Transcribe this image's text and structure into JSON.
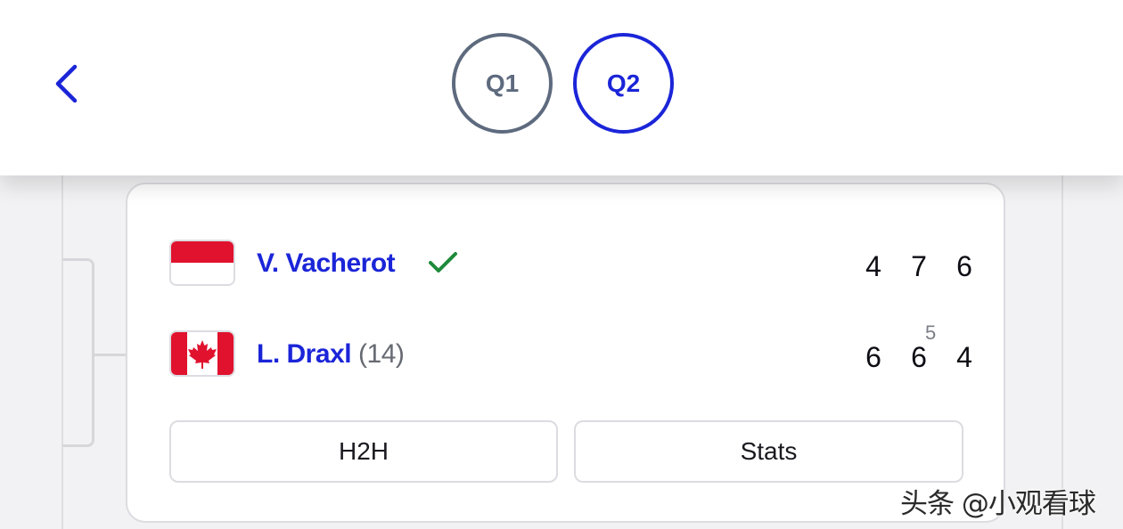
{
  "header": {
    "tabs": [
      {
        "label": "Q1",
        "active": false
      },
      {
        "label": "Q2",
        "active": true
      }
    ]
  },
  "match": {
    "players": [
      {
        "name": "V. Vacherot",
        "seed": "",
        "flag": "monaco-flag",
        "winner": true,
        "scores": [
          "4",
          "7",
          "6"
        ],
        "tiebreak": ""
      },
      {
        "name": "L. Draxl",
        "seed": "(14)",
        "flag": "canada-flag",
        "winner": false,
        "scores": [
          "6",
          "6",
          "4"
        ],
        "tiebreak": "5"
      }
    ],
    "buttons": {
      "h2h": "H2H",
      "stats": "Stats"
    }
  },
  "watermark": "头条 @小观看球",
  "colors": {
    "accent": "#1b25d8",
    "inactive_tab": "#5e6a7e",
    "winner_check": "#1e8a3a",
    "text": "#0d0d14"
  }
}
